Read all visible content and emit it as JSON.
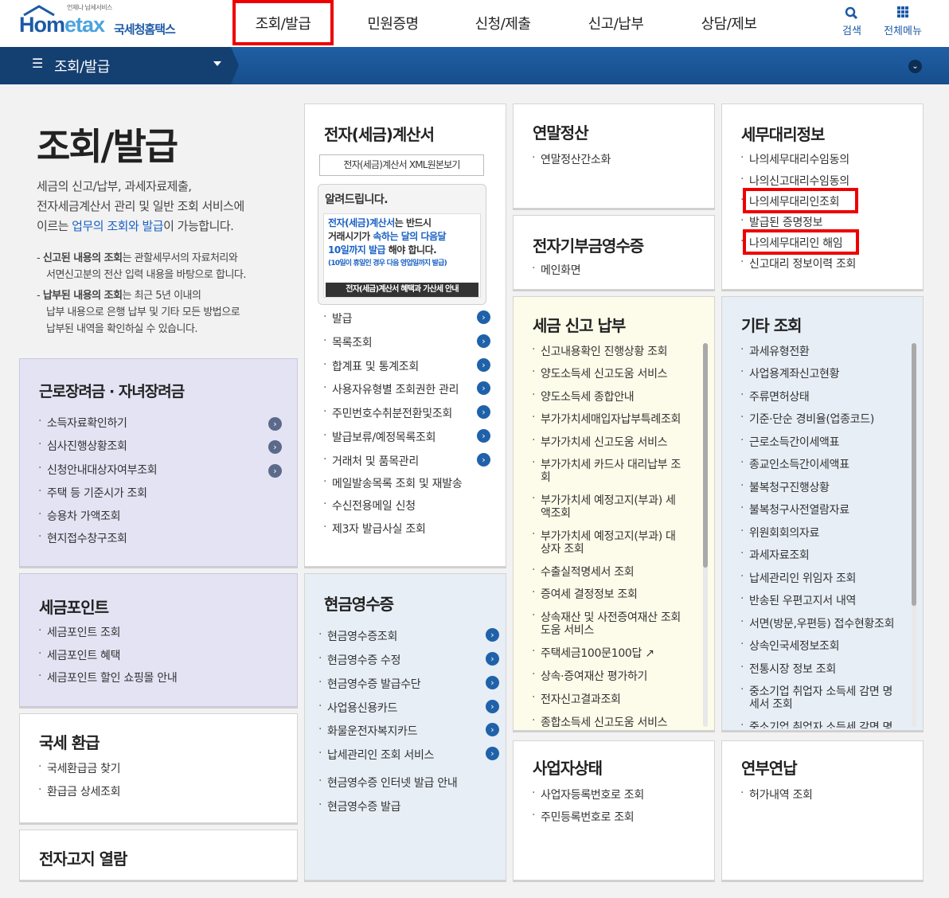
{
  "logo": {
    "tagline": "언제나 납세서비스",
    "home": "Hom",
    "etax": "etax",
    "name": "국세청홈택스"
  },
  "nav": [
    "조회/발급",
    "민원증명",
    "신청/제출",
    "신고/납부",
    "상담/제보"
  ],
  "top_icons": {
    "search": "검색",
    "allmenu": "전체메뉴"
  },
  "bar_title": "조회/발급",
  "intro": {
    "title": "조회/발급",
    "desc1": "세금의 신고/납부, 과세자료제출,",
    "desc2": "전자세금계산서 관리 및 일반 조회 서비스에",
    "desc3a": "이르는 ",
    "desc3b": "업무의 조회와 발급",
    "desc3c": "이 가능합니다.",
    "n1a": "신고된 내용의 조회",
    "n1b": "는 관할세무서의 자료처리와",
    "n1c": "서면신고분의 전산 입력 내용을 바탕으로 합니다.",
    "n2a": "납부된 내용의 조회",
    "n2b": "는 최근 5년 이내의",
    "n2c": "납부 내용으로 은행 납부 및 기타 모든 방법으로",
    "n2d": "납부된 내역을 확인하실 수 있습니다."
  },
  "card_labor": {
    "title": "근로장려금 · 자녀장려금",
    "items": [
      "소득자료확인하기",
      "심사진행상황조회",
      "신청안내대상자여부조회",
      "주택 등 기준시가 조회",
      "승용차 가액조회",
      "현지접수창구조회"
    ]
  },
  "card_point": {
    "title": "세금포인트",
    "items": [
      "세금포인트 조회",
      "세금포인트 혜택",
      "세금포인트 할인 쇼핑몰 안내"
    ]
  },
  "card_refund": {
    "title": "국세 환급",
    "items": [
      "국세환급금 찾기",
      "환급금 상세조회"
    ]
  },
  "card_enotice": {
    "title": "전자고지 열람"
  },
  "card_einvoice": {
    "title": "전자(세금)계산서",
    "btn": "전자(세금)계산서 XML원본보기",
    "notice_title": "알려드립니다.",
    "nt1a": "전자(세금)계산서",
    "nt1b": "는 반드시",
    "nt2a": "거래시기가 ",
    "nt2b": "속하는 달의 다음달",
    "nt3a": "10일까지 발급",
    "nt3b": " 해야 합니다.",
    "nt4": "(10일이 휴일인 경우 다음 영업일까지 발급)",
    "nt_banner": "전자(세금)계산서 혜택과 가산세 안내",
    "items": [
      "발급",
      "목록조회",
      "합계표 및 통계조회",
      "사용자유형별 조회권한 관리",
      "주민번호수취분전환및조회",
      "발급보류/예정목록조회",
      "거래처 및 품목관리",
      "메일발송목록 조회 및 재발송",
      "수신전용메일 신청",
      "제3자 발급사실 조회"
    ]
  },
  "card_cash": {
    "title": "현금영수증",
    "items": [
      "현금영수증조회",
      "현금영수증 수정",
      "현금영수증 발급수단",
      "사업용신용카드",
      "화물운전자복지카드",
      "납세관리인 조회 서비스",
      "현금영수증 인터넷 발급 안내",
      "현금영수증 발급"
    ]
  },
  "card_yearend": {
    "title": "연말정산",
    "items": [
      "연말정산간소화"
    ]
  },
  "card_donation": {
    "title": "전자기부금영수증",
    "items": [
      "메인화면"
    ]
  },
  "card_tax": {
    "title": "세금 신고 납부",
    "items": [
      "신고내용확인 진행상황 조회",
      "양도소득세 신고도움 서비스",
      "양도소득세 종합안내",
      "부가가치세매입자납부특례조회",
      "부가가치세 신고도움 서비스",
      "부가가치세 카드사 대리납부 조",
      "회",
      "부가가치세 예정고지(부과) 세",
      "액조회",
      "부가가치세 예정고지(부과) 대",
      "상자 조회",
      "수출실적명세서 조회",
      "증여세 결정정보 조회",
      "상속재산 및 사전증여재산 조회",
      "도움 서비스",
      "주택세금100문100답",
      "상속·증여재산 평가하기",
      "전자신고결과조회",
      "종합소득세 신고도움 서비스"
    ]
  },
  "card_biz": {
    "title": "사업자상태",
    "items": [
      "사업자등록번호로 조회",
      "주민등록번호로 조회"
    ]
  },
  "card_agent": {
    "title": "세무대리정보",
    "items": [
      "나의세무대리수임동의",
      "나의신고대리수임동의",
      "나의세무대리인조회",
      "발급된 증명정보",
      "나의세무대리인 해임",
      "신고대리 정보이력 조회"
    ]
  },
  "card_etc": {
    "title": "기타 조회",
    "items": [
      "과세유형전환",
      "사업용계좌신고현황",
      "주류면허상태",
      "기준·단순 경비율(업종코드)",
      "근로소득간이세액표",
      "종교인소득간이세액표",
      "불복청구진행상황",
      "불복청구사전열람자료",
      "위원회회의자료",
      "과세자료조회",
      "납세관리인 위임자 조회",
      "반송된 우편고지서 내역",
      "서면(방문,우편등) 접수현황조회",
      "상속인국세정보조회",
      "전통시장 정보 조회",
      "중소기업 취업자 소득세 감면 명",
      "세서 조회",
      "중소기업 취업자 소득세 감면 명"
    ]
  },
  "card_install": {
    "title": "연부연납",
    "items": [
      "허가내역 조회"
    ]
  },
  "colors": {
    "brand": "#1c5aa6",
    "highlight": "#e00000",
    "link": "#1b62c4"
  }
}
